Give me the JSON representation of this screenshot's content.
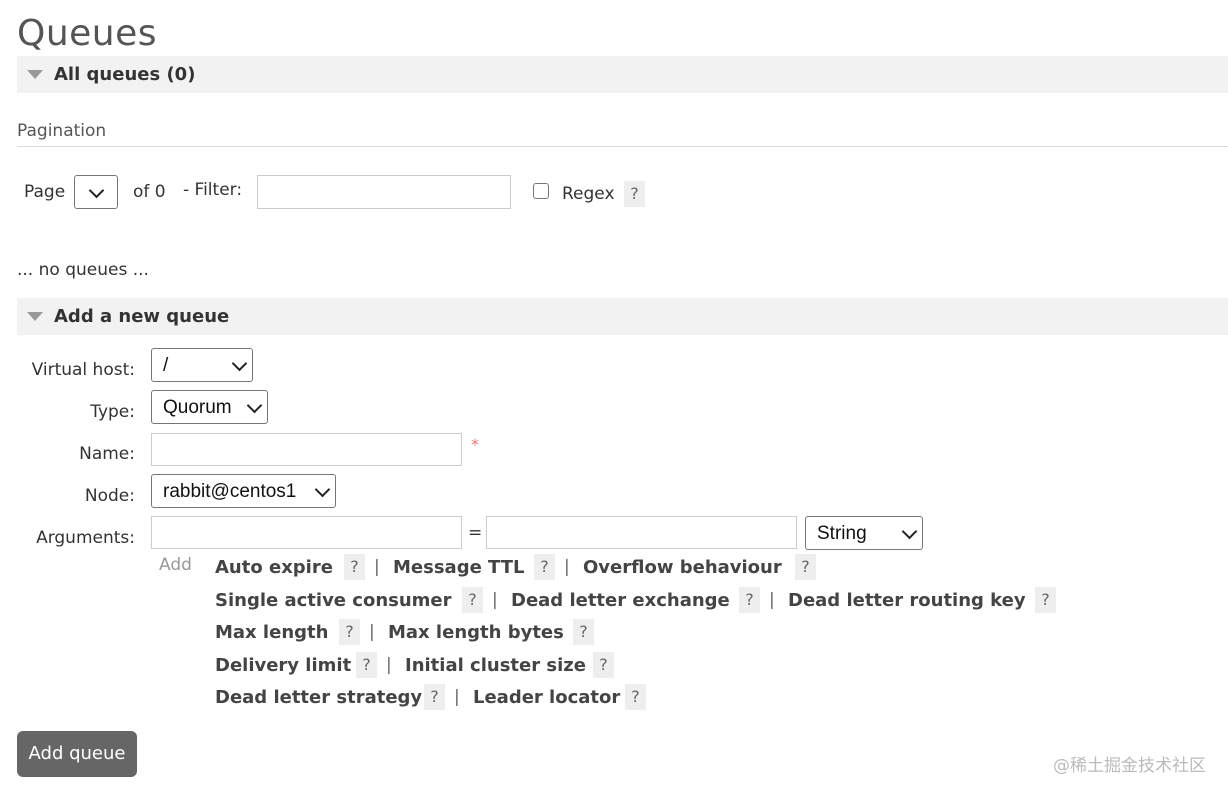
{
  "page_title": "Queues",
  "all_queues": {
    "label": "All queues (0)"
  },
  "pagination": {
    "label": "Pagination",
    "page_label": "Page",
    "of_label": "of 0",
    "filter_label": "- Filter:",
    "filter_value": "",
    "regex_label": "Regex",
    "help": "?"
  },
  "empty_message": "... no queues ...",
  "add_queue_section": {
    "label": "Add a new queue",
    "virtual_host": {
      "label": "Virtual host:",
      "value": "/"
    },
    "type": {
      "label": "Type:",
      "value": "Quorum"
    },
    "name": {
      "label": "Name:",
      "value": "",
      "required": "*"
    },
    "node": {
      "label": "Node:",
      "value": "rabbit@centos1"
    },
    "arguments": {
      "label": "Arguments:",
      "key": "",
      "eq": "=",
      "value": "",
      "type_value": "String",
      "add_label": "Add"
    },
    "argument_links": [
      "Auto expire",
      "Message TTL",
      "Overflow behaviour",
      "Single active consumer",
      "Dead letter exchange",
      "Dead letter routing key",
      "Max length",
      "Max length bytes",
      "Delivery limit",
      "Initial cluster size",
      "Dead letter strategy",
      "Leader locator"
    ],
    "separator": "|",
    "help": "?",
    "submit_label": "Add queue"
  },
  "watermark": "@稀土掘金技术社区"
}
